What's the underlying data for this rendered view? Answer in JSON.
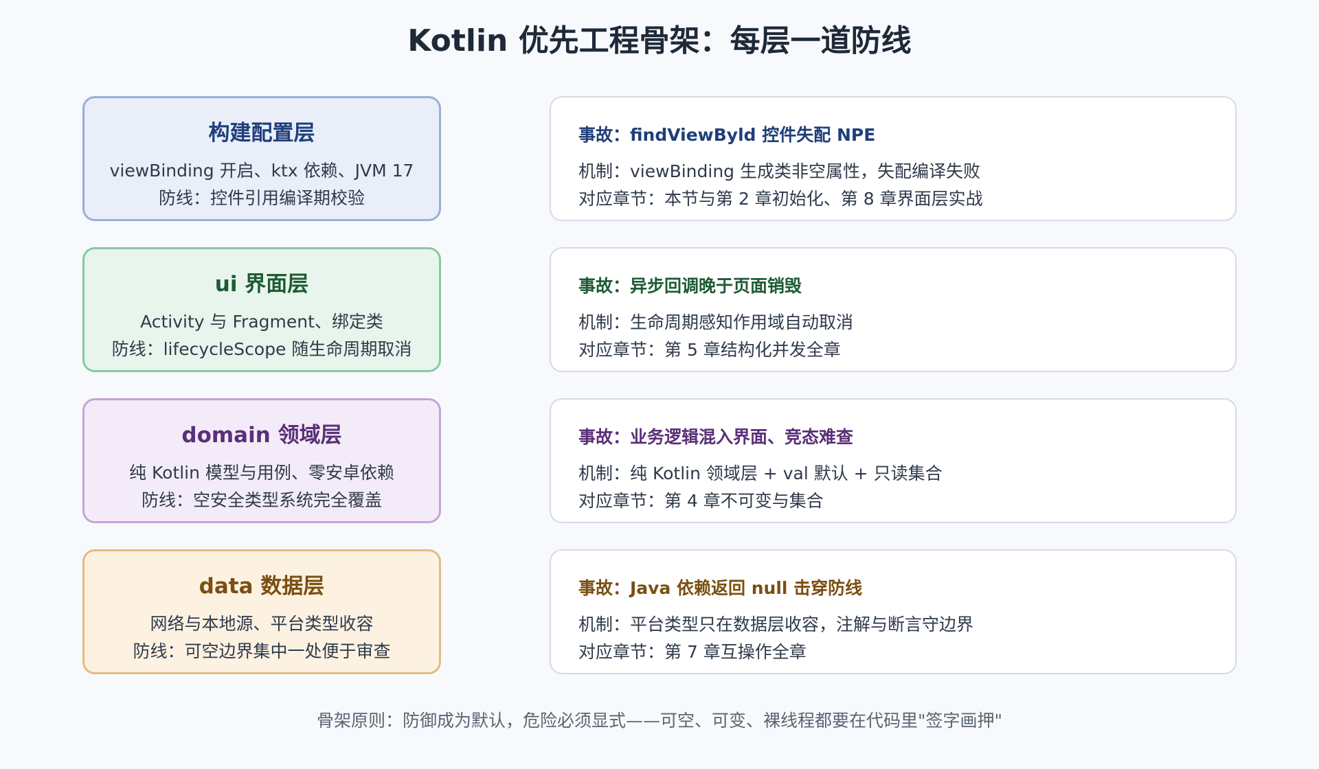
{
  "title": "Kotlin 优先工程骨架：每层一道防线",
  "rows": [
    {
      "layer": {
        "name": "构建配置层",
        "line1": "viewBinding 开启、ktx 依赖、JVM 17",
        "line2": "防线：控件引用编译期校验"
      },
      "incident": {
        "title": "事故：findViewByld 控件失配 NPE",
        "mechanism": "机制：viewBinding 生成类非空属性，失配编译失败",
        "chapter": "对应章节：本节与第 2 章初始化、第 8 章界面层实战"
      },
      "colors": {
        "border": "#9aaed6",
        "fill": "#e9eef9",
        "text": "#1f3f7a"
      }
    },
    {
      "layer": {
        "name": "ui 界面层",
        "line1": "Activity 与 Fragment、绑定类",
        "line2": "防线：lifecycleScope 随生命周期取消"
      },
      "incident": {
        "title": "事故：异步回调晚于页面销毁",
        "mechanism": "机制：生命周期感知作用域自动取消",
        "chapter": "对应章节：第 5 章结构化并发全章"
      },
      "colors": {
        "border": "#86c9a2",
        "fill": "#e8f5ec",
        "text": "#1e5b34"
      }
    },
    {
      "layer": {
        "name": "domain 领域层",
        "line1": "纯 Kotlin 模型与用例、零安卓依赖",
        "line2": "防线：空安全类型系统完全覆盖"
      },
      "incident": {
        "title": "事故：业务逻辑混入界面、竞态难查",
        "mechanism": "机制：纯 Kotlin 领域层 + val 默认 + 只读集合",
        "chapter": "对应章节：第 4 章不可变与集合"
      },
      "colors": {
        "border": "#c3a4d6",
        "fill": "#f3ecf8",
        "text": "#5a2f78"
      }
    },
    {
      "layer": {
        "name": "data 数据层",
        "line1": "网络与本地源、平台类型收容",
        "line2": "防线：可空边界集中一处便于审查"
      },
      "incident": {
        "title": "事故：Java 依赖返回 null 击穿防线",
        "mechanism": "机制：平台类型只在数据层收容，注解与断言守边界",
        "chapter": "对应章节：第 7 章互操作全章"
      },
      "colors": {
        "border": "#e3bb80",
        "fill": "#fdf2e2",
        "text": "#7a4f12"
      }
    }
  ],
  "footer": "骨架原则：防御成为默认，危险必须显式——可空、可变、裸线程都要在代码里\"签字画押\""
}
